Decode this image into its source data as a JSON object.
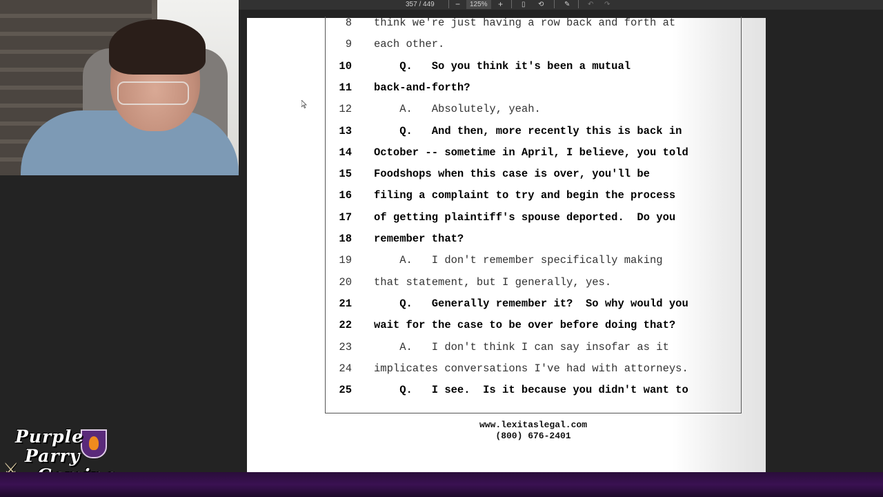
{
  "toolbar": {
    "page_indicator": "357 / 449",
    "zoom_out": "−",
    "zoom_level": "125%",
    "zoom_in": "+",
    "fit_icon": "▯",
    "rotate_icon": "⟲",
    "draw_icon": "✎",
    "undo_icon": "↶",
    "redo_icon": "↷"
  },
  "transcript": {
    "lines": [
      {
        "num": "8",
        "text": "think we're just having a row back and forth at",
        "bold": false
      },
      {
        "num": "9",
        "text": "each other.",
        "bold": false
      },
      {
        "num": "10",
        "text": "    Q.   So you think it's been a mutual",
        "bold": true
      },
      {
        "num": "11",
        "text": "back-and-forth?",
        "bold": true
      },
      {
        "num": "12",
        "text": "    A.   Absolutely, yeah.",
        "bold": false
      },
      {
        "num": "13",
        "text": "    Q.   And then, more recently this is back in",
        "bold": true
      },
      {
        "num": "14",
        "text": "October -- sometime in April, I believe, you told",
        "bold": true
      },
      {
        "num": "15",
        "text": "Foodshops when this case is over, you'll be",
        "bold": true
      },
      {
        "num": "16",
        "text": "filing a complaint to try and begin the process",
        "bold": true
      },
      {
        "num": "17",
        "text": "of getting plaintiff's spouse deported.  Do you",
        "bold": true
      },
      {
        "num": "18",
        "text": "remember that?",
        "bold": true
      },
      {
        "num": "19",
        "text": "    A.   I don't remember specifically making",
        "bold": false
      },
      {
        "num": "20",
        "text": "that statement, but I generally, yes.",
        "bold": false
      },
      {
        "num": "21",
        "text": "    Q.   Generally remember it?  So why would you",
        "bold": true
      },
      {
        "num": "22",
        "text": "wait for the case to be over before doing that?",
        "bold": true
      },
      {
        "num": "23",
        "text": "    A.   I don't think I can say insofar as it",
        "bold": false
      },
      {
        "num": "24",
        "text": "implicates conversations I've had with attorneys.",
        "bold": false
      },
      {
        "num": "25",
        "text": "    Q.   I see.  Is it because you didn't want to",
        "bold": true
      }
    ]
  },
  "footer": {
    "website": "www.lexitaslegal.com",
    "phone": "(800) 676-2401"
  },
  "logo": {
    "line1": "Purple",
    "line2": "Parry",
    "line3": "Gaming"
  },
  "icons": {
    "cursor": "arrow-cursor-icon",
    "shield": "flame-shield-icon",
    "swords": "crossed-swords-icon"
  },
  "colors": {
    "page_bg": "#ffffff",
    "desktop_bg": "#232323",
    "toolbar_bg": "#323232",
    "bottom_bar": "#3a1152",
    "logo_accent": "#5a2a7a"
  }
}
